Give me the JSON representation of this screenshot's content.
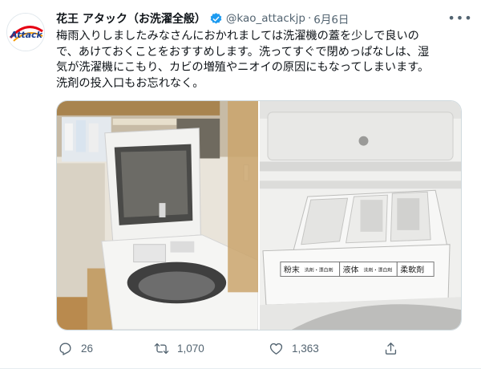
{
  "tweet": {
    "display_name": "花王 アタック（お洗濯全般）",
    "handle": "@kao_attackjp",
    "separator": "·",
    "date": "6月6日",
    "more_icon": "ellipsis-icon",
    "avatar_logo_text": "Attack",
    "text_lines": [
      "梅雨入りしましたみなさんにおかれましては洗濯機の蓋を少しで良いの",
      "で、あけておくことをおすすめします。洗ってすぐで閉めっぱなしは、湿",
      "気が洗濯機にこもり、カビの増殖やニオイの原因にもなってしまいます。",
      "洗剤の投入口もお忘れなく。"
    ],
    "media": {
      "drawer_labels": {
        "powder": "粉末",
        "powder_sub": "洗剤・漂白剤",
        "liquid": "液体",
        "liquid_sub": "洗剤・漂白剤",
        "softener": "柔軟剤"
      }
    },
    "actions": {
      "reply": {
        "icon": "reply-icon",
        "count": "26"
      },
      "retweet": {
        "icon": "retweet-icon",
        "count": "1,070"
      },
      "like": {
        "icon": "heart-icon",
        "count": "1,363"
      },
      "share": {
        "icon": "share-icon"
      }
    },
    "colors": {
      "brand_red": "#e60012",
      "verified_blue": "#1d9bf0",
      "muted": "#536471"
    }
  }
}
